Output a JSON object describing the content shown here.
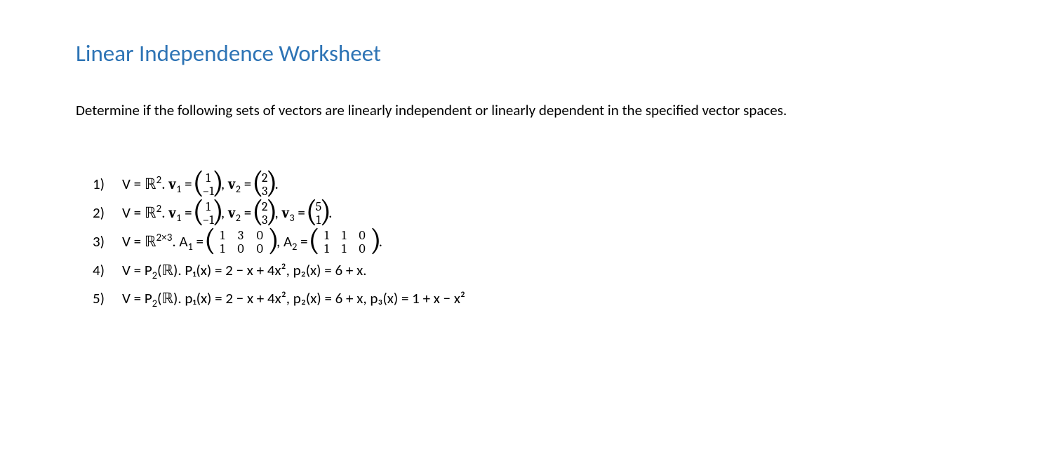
{
  "title": "Linear Independence Worksheet",
  "intro": "Determine if the following sets of vectors are linearly independent or linearly dependent in the specified vector spaces.",
  "items": [
    {
      "num": "1)",
      "space_prefix": "V = ",
      "space_set": "ℝ",
      "space_exp": "2",
      "dot": ". ",
      "v1_label": "v",
      "v1_sub": "1",
      "v1_top": "1",
      "v1_bot": "−1",
      "v2_label": "v",
      "v2_sub": "2",
      "v2_top": "2",
      "v2_bot": "3",
      "tail": "."
    },
    {
      "num": "2)",
      "space_prefix": "V = ",
      "space_set": "ℝ",
      "space_exp": "2",
      "dot": ". ",
      "v1_label": "v",
      "v1_sub": "1",
      "v1_top": "1",
      "v1_bot": "−1",
      "v2_label": "v",
      "v2_sub": "2",
      "v2_top": "2",
      "v2_bot": "3",
      "v3_label": "v",
      "v3_sub": "3",
      "v3_top": "5",
      "v3_bot": "1",
      "tail": "."
    },
    {
      "num": "3)",
      "space_prefix": "V = ",
      "space_set": "ℝ",
      "space_exp": "2×3",
      "dot": ". ",
      "a1_label": "A",
      "a1_sub": "1",
      "a1": [
        [
          "1",
          "3",
          "0"
        ],
        [
          "1",
          "0",
          "0"
        ]
      ],
      "a2_label": "A",
      "a2_sub": "2",
      "a2": [
        [
          "1",
          "1",
          "0"
        ],
        [
          "1",
          "1",
          "0"
        ]
      ],
      "tail": "."
    },
    {
      "num": "4)",
      "space_prefix": "V = P",
      "space_sub": "2",
      "space_arg": "(ℝ). ",
      "body": "P₁(x) = 2 − x + 4x², p₂(x) = 6 + x."
    },
    {
      "num": "5)",
      "space_prefix": "V = P",
      "space_sub": "2",
      "space_arg": "(ℝ). ",
      "body": "p₁(x) = 2 − x + 4x², p₂(x) = 6 + x, p₃(x) = 1 + x − x²"
    }
  ],
  "eq": " = ",
  "comma": ", "
}
